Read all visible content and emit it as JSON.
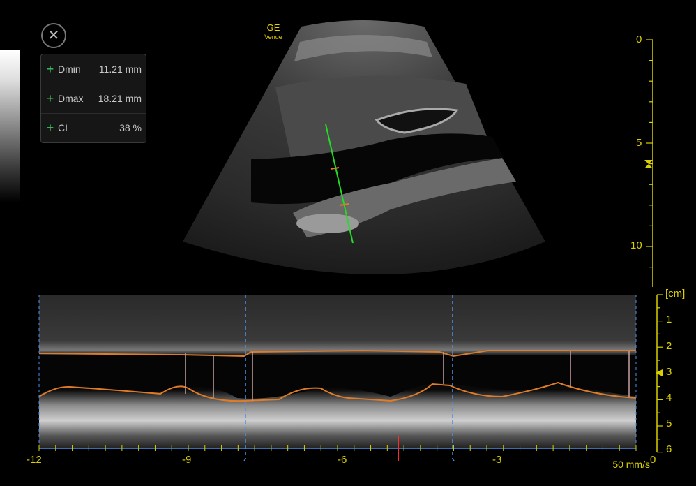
{
  "top_bar": {
    "close_icon": "✕"
  },
  "brand": {
    "name": "GE",
    "model": "Venue"
  },
  "measurements": [
    {
      "icon": "plus-icon",
      "label": "Dmin",
      "value": "11.21 mm"
    },
    {
      "icon": "plus-icon",
      "label": "Dmax",
      "value": "18.21 mm"
    },
    {
      "icon": "plus-icon",
      "label": "CI",
      "value": "38 %"
    }
  ],
  "depth_scale": {
    "labels": [
      "0",
      "5",
      "10"
    ],
    "range_cm": [
      0,
      12
    ]
  },
  "mmode_scale": {
    "unit": "[cm]",
    "labels": [
      "1",
      "2",
      "3",
      "4",
      "5",
      "6"
    ]
  },
  "time_axis": {
    "labels": [
      "-12",
      "-9",
      "-6",
      "-3",
      "0"
    ]
  },
  "sweep_speed": "50 mm/s",
  "colors": {
    "scale": "#d8d000",
    "cursor": "#22dd22",
    "trace": "#e07b26",
    "marker": "#4d8fe8",
    "panel_plus": "#39c15a"
  }
}
